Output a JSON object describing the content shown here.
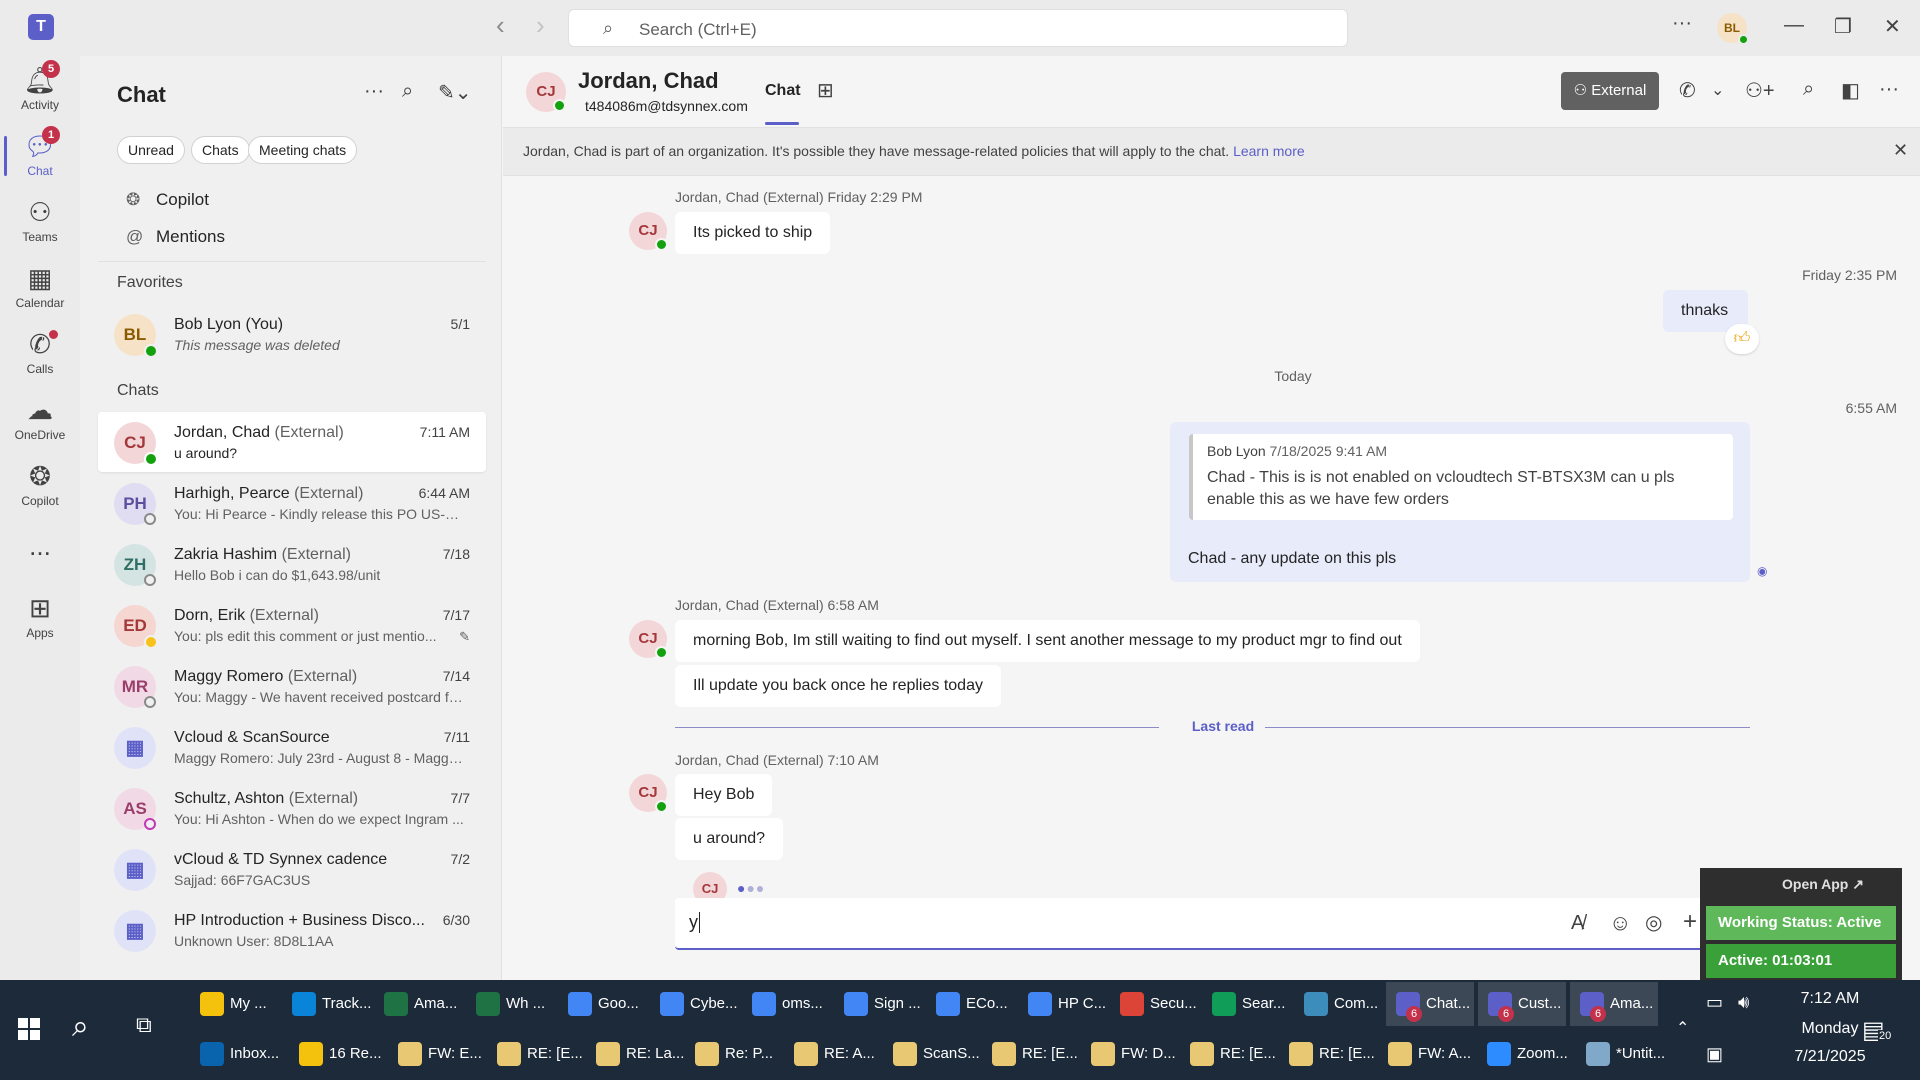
{
  "titlebar": {
    "search_placeholder": "Search (Ctrl+E)",
    "user_initials": "BL"
  },
  "rail": [
    {
      "label": "Activity",
      "badge": "5"
    },
    {
      "label": "Chat",
      "badge": "1"
    },
    {
      "label": "Teams"
    },
    {
      "label": "Calendar"
    },
    {
      "label": "Calls"
    },
    {
      "label": "OneDrive"
    },
    {
      "label": "Copilot"
    },
    {
      "label": "..."
    },
    {
      "label": "Apps"
    }
  ],
  "sidebar": {
    "title": "Chat",
    "filters": [
      "Unread",
      "Chats",
      "Meeting chats"
    ],
    "quick": [
      "Copilot",
      "Mentions"
    ],
    "favorites_label": "Favorites",
    "favorite": {
      "initials": "BL",
      "name": "Bob Lyon (You)",
      "preview": "This message was deleted",
      "time": "5/1"
    },
    "chats_label": "Chats",
    "chats": [
      {
        "initials": "CJ",
        "name": "Jordan, Chad",
        "ext": "(External)",
        "preview": "u around?",
        "time": "7:11 AM"
      },
      {
        "initials": "PH",
        "name": "Harhigh, Pearce",
        "ext": "(External)",
        "preview": "You: Hi Pearce -  Kindly release this PO US-Q3...",
        "time": "6:44 AM"
      },
      {
        "initials": "ZH",
        "name": "Zakria Hashim",
        "ext": "(External)",
        "preview": "Hello Bob i can do $1,643.98/unit",
        "time": "7/18"
      },
      {
        "initials": "ED",
        "name": "Dorn, Erik",
        "ext": "(External)",
        "preview": "You: pls edit this comment or just mentio...",
        "time": "7/17"
      },
      {
        "initials": "MR",
        "name": "Maggy Romero",
        "ext": "(External)",
        "preview": "You: Maggy - We havent received postcard fo...",
        "time": "7/14"
      },
      {
        "initials": "▦",
        "name": "Vcloud & ScanSource",
        "ext": "",
        "preview": "Maggy Romero: July 23rd - August 8 - Maggy...",
        "time": "7/11"
      },
      {
        "initials": "AS",
        "name": "Schultz, Ashton",
        "ext": "(External)",
        "preview": "You: Hi Ashton -  When do we expect Ingram ...",
        "time": "7/7"
      },
      {
        "initials": "▦",
        "name": "vCloud & TD Synnex cadence",
        "ext": "",
        "preview": "Sajjad: 66F7GAC3US",
        "time": "7/2"
      },
      {
        "initials": "▦",
        "name": "HP Introduction + Business Disco...",
        "ext": "",
        "preview": "Unknown User: 8D8L1AA",
        "time": "6/30"
      }
    ]
  },
  "header": {
    "initials": "CJ",
    "name": "Jordan, Chad",
    "email": "t484086m@tdsynnex.com",
    "tab": "Chat",
    "external_label": "External"
  },
  "banner": {
    "text": "Jordan, Chad is part of an organization. It's possible they have message-related policies that will apply to the chat.",
    "link": "Learn more"
  },
  "messages": {
    "m1_meta": "Jordan, Chad (External)  Friday 2:29 PM",
    "m1": "Its picked to ship",
    "m2_meta": "Friday 2:35 PM",
    "m2": "thnaks",
    "today": "Today",
    "m3_meta": "6:55 AM",
    "quote_author": "Bob Lyon",
    "quote_time": "7/18/2025 9:41 AM",
    "quote_text1": "Chad - This is is not enabled on vcloudtech ST-BTSX3M can u pls",
    "quote_text2": "enable this as we have few orders",
    "m3": "Chad - any update on this pls",
    "m4_meta": "Jordan, Chad (External)  6:58 AM",
    "m4a": "morning Bob, Im still waiting to find out myself.  I sent another message to my product mgr to find out",
    "m4b": "Ill update you back once he replies today",
    "last_read": "Last read",
    "m5_meta": "Jordan, Chad (External)  7:10 AM",
    "m5a": "Hey Bob",
    "m5b": "u around?",
    "compose_value": "y"
  },
  "widget": {
    "open": "Open App ↗",
    "status": "Working Status: Active",
    "active": "Active: 01:03:01"
  },
  "taskbar": {
    "row1": [
      {
        "label": "My ...",
        "color": "#f4c20d"
      },
      {
        "label": "Track...",
        "color": "#0a84d8"
      },
      {
        "label": "Ama...",
        "color": "#1f7244"
      },
      {
        "label": "Wh ...",
        "color": "#1f7244"
      },
      {
        "label": "Goo...",
        "color": "#4285f4"
      },
      {
        "label": "Cybe...",
        "color": "#4285f4"
      },
      {
        "label": "oms...",
        "color": "#4285f4"
      },
      {
        "label": "Sign ...",
        "color": "#4285f4"
      },
      {
        "label": "ECo...",
        "color": "#4285f4"
      },
      {
        "label": "HP C...",
        "color": "#4285f4"
      },
      {
        "label": "Secu...",
        "color": "#db4437"
      },
      {
        "label": "Sear...",
        "color": "#0f9d58"
      },
      {
        "label": "Com...",
        "color": "#3c8dbc"
      },
      {
        "label": "Chat...",
        "color": "#5b5fc7",
        "badge": "6"
      },
      {
        "label": "Cust...",
        "color": "#5b5fc7",
        "badge": "6"
      },
      {
        "label": "Ama...",
        "color": "#5b5fc7",
        "badge": "6"
      }
    ],
    "row2": [
      {
        "label": "Inbox...",
        "color": "#0a64ad"
      },
      {
        "label": "16 Re...",
        "color": "#f4c20d"
      },
      {
        "label": "FW: E...",
        "color": "#e8c872"
      },
      {
        "label": "RE: [E...",
        "color": "#e8c872"
      },
      {
        "label": "RE: La...",
        "color": "#e8c872"
      },
      {
        "label": "Re: P...",
        "color": "#e8c872"
      },
      {
        "label": "RE: A...",
        "color": "#e8c872"
      },
      {
        "label": "ScanS...",
        "color": "#e8c872"
      },
      {
        "label": "RE: [E...",
        "color": "#e8c872"
      },
      {
        "label": "FW: D...",
        "color": "#e8c872"
      },
      {
        "label": "RE: [E...",
        "color": "#e8c872"
      },
      {
        "label": "RE: [E...",
        "color": "#e8c872"
      },
      {
        "label": "FW: A...",
        "color": "#e8c872"
      },
      {
        "label": "Zoom...",
        "color": "#2d8cff"
      },
      {
        "label": "*Untit...",
        "color": "#7fa8c9"
      }
    ],
    "time": "7:12 AM",
    "day": "Monday",
    "date": "7/21/2025",
    "notif": "20"
  }
}
